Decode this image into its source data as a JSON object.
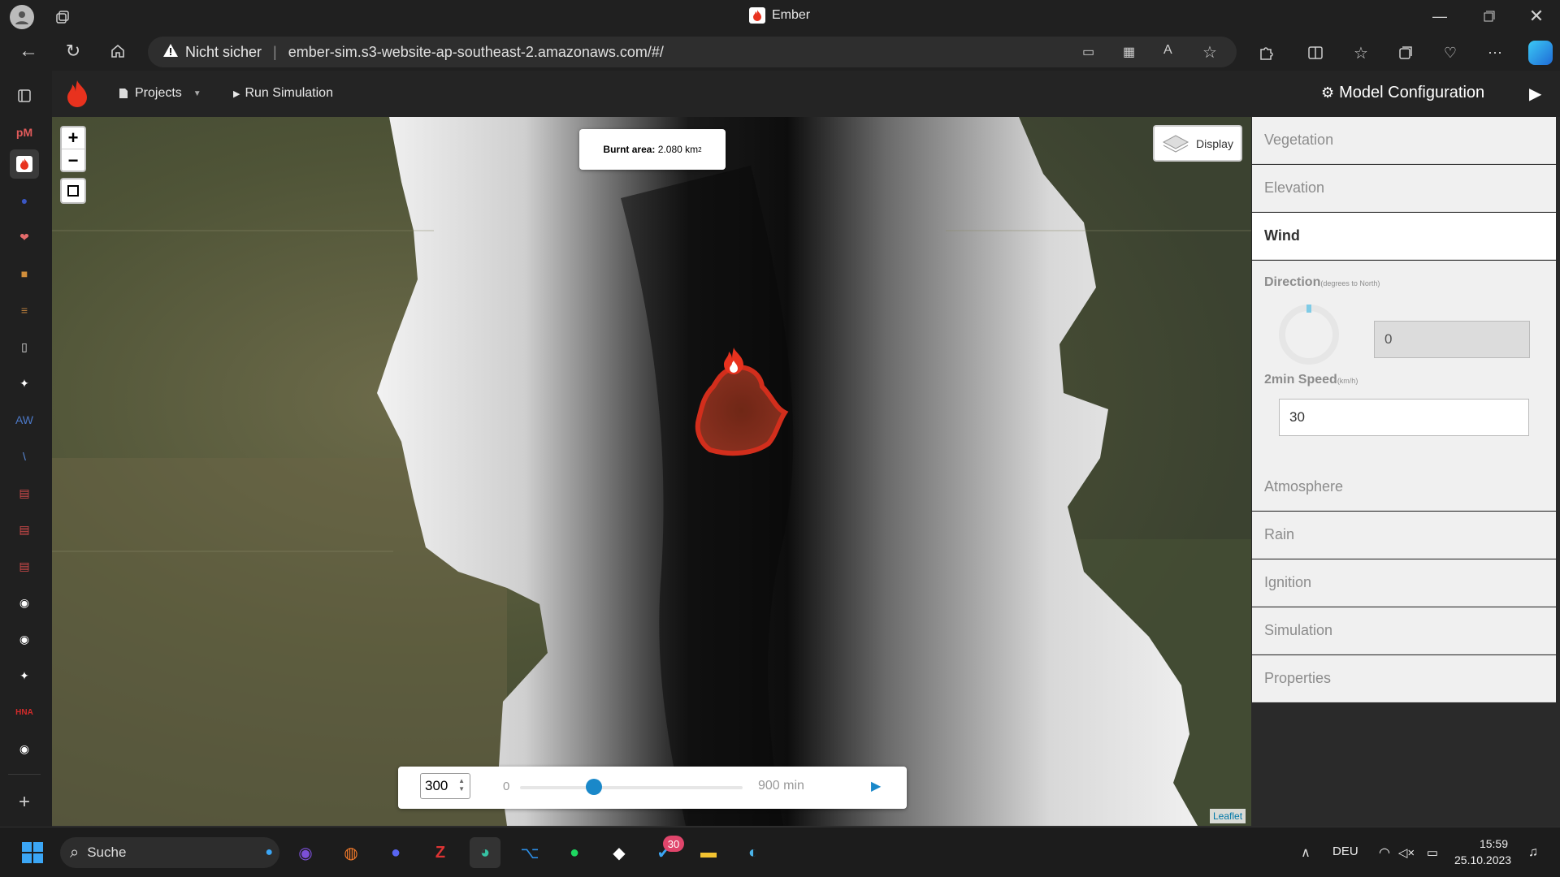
{
  "window": {
    "title": "Ember"
  },
  "browser": {
    "security_label": "Nicht sicher",
    "url": "ember-sim.s3-website-ap-southeast-2.amazonaws.com/#/"
  },
  "app": {
    "nav": {
      "projects": "Projects",
      "run": "Run Simulation",
      "config": "Model Configuration"
    },
    "map": {
      "burnt_label": "Burnt area:",
      "burnt_value": "2.080 km",
      "burnt_unit_sup": "2",
      "display": "Display",
      "attribution": "Leaflet",
      "zoom_in": "+",
      "zoom_out": "−"
    },
    "timeline": {
      "value": "300",
      "min": "0",
      "max": "900 min",
      "progress": 0.3333
    }
  },
  "panel": {
    "sections": [
      "Vegetation",
      "Elevation",
      "Wind",
      "Atmosphere",
      "Rain",
      "Ignition",
      "Simulation",
      "Properties"
    ],
    "active": "Wind",
    "wind": {
      "direction_label": "Direction",
      "direction_sub": "(degrees to North)",
      "direction_value": "0",
      "speed_label": "2min Speed",
      "speed_sub": "(km/h)",
      "speed_value": "30"
    }
  },
  "taskbar": {
    "search": "Suche",
    "badge": "30",
    "lang": "DEU",
    "time": "15:59",
    "date": "25.10.2023"
  },
  "colors": {
    "fire": "#e8321e",
    "accent": "#1a88c9"
  }
}
